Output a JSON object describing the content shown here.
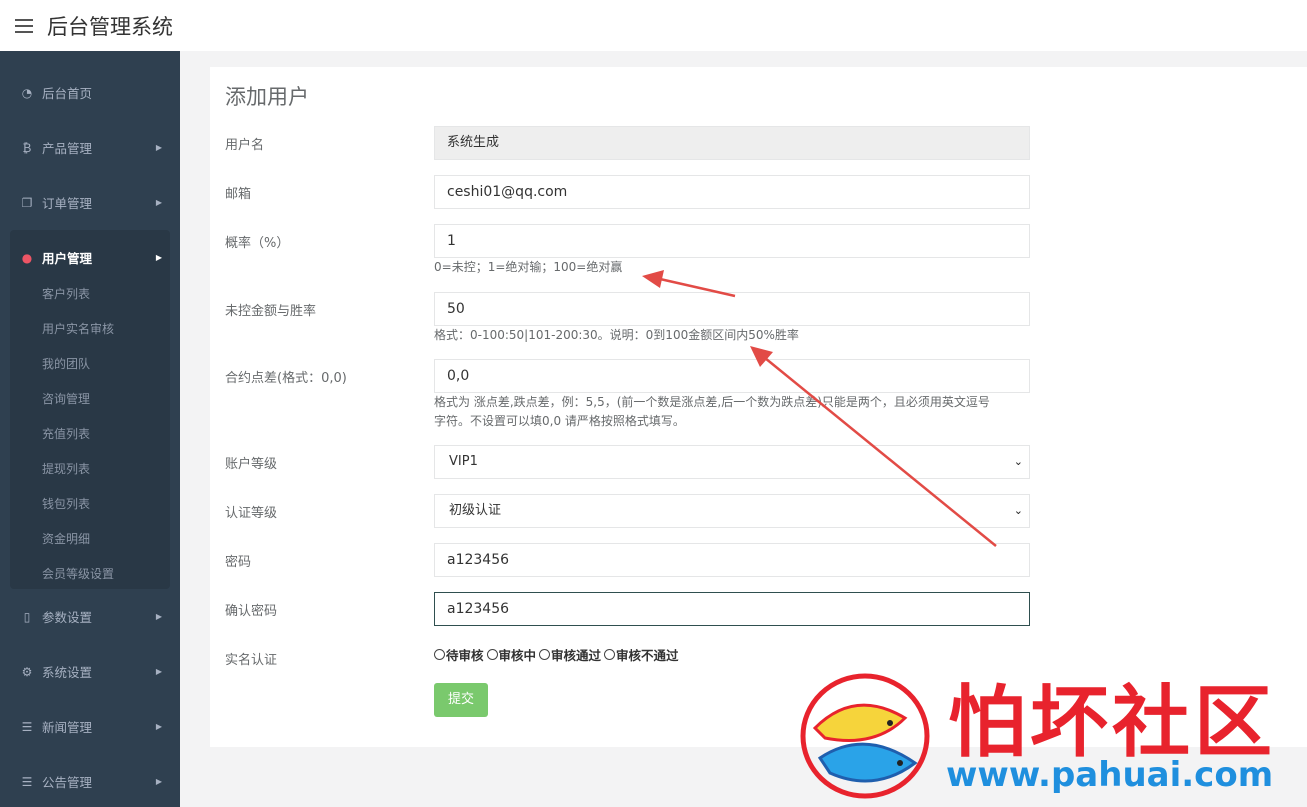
{
  "header": {
    "title": "后台管理系统",
    "menu_icon": "hamburger-menu-icon"
  },
  "sidebar": {
    "items": [
      {
        "label": "后台首页",
        "icon": "dashboard-icon",
        "has_arrow": false
      },
      {
        "label": "产品管理",
        "icon": "bitcoin-icon",
        "has_arrow": true
      },
      {
        "label": "订单管理",
        "icon": "copy-document-icon",
        "has_arrow": true
      },
      {
        "label": "用户管理",
        "icon": "user-icon",
        "has_arrow": true,
        "active": true,
        "children": [
          "客户列表",
          "用户实名审核",
          "我的团队",
          "咨询管理",
          "充值列表",
          "提现列表",
          "钱包列表",
          "资金明细",
          "会员等级设置"
        ]
      },
      {
        "label": "参数设置",
        "icon": "file-icon",
        "has_arrow": true
      },
      {
        "label": "系统设置",
        "icon": "gears-icon",
        "has_arrow": true
      },
      {
        "label": "新闻管理",
        "icon": "list-icon",
        "has_arrow": true
      },
      {
        "label": "公告管理",
        "icon": "list-icon",
        "has_arrow": true
      }
    ]
  },
  "form": {
    "title": "添加用户",
    "username": {
      "label": "用户名",
      "value": "系统生成"
    },
    "email": {
      "label": "邮箱",
      "value": "ceshi01@qq.com"
    },
    "probability": {
      "label": "概率（%）",
      "value": "1",
      "help": "0=未控；1=绝对输；100=绝对赢"
    },
    "uncontrolled": {
      "label": "未控金额与胜率",
      "value": "50",
      "help": "格式：0-100:50|101-200:30。说明：0到100金额区间内50%胜率"
    },
    "spread": {
      "label": "合约点差(格式：0,0)",
      "value": "0,0",
      "help_line1": "格式为 涨点差,跌点差，例：5,5，(前一个数是涨点差,后一个数为跌点差)只能是两个，且必须用英文逗号",
      "help_line2": "字符。不设置可以填0,0 请严格按照格式填写。"
    },
    "account_level": {
      "label": "账户等级",
      "selected": "VIP1"
    },
    "cert_level": {
      "label": "认证等级",
      "selected": "初级认证"
    },
    "password": {
      "label": "密码",
      "value": "a123456"
    },
    "confirm_password": {
      "label": "确认密码",
      "value": "a123456"
    },
    "realname": {
      "label": "实名认证",
      "options": [
        "待审核",
        "审核中",
        "审核通过",
        "审核不通过"
      ]
    },
    "submit_label": "提交"
  },
  "watermark": {
    "text": "怕坏社区",
    "url": "www.pahuai.com"
  },
  "colors": {
    "sidebar_bg": "#2f4050",
    "submit_bg": "#7ac96d",
    "active_icon": "#ed5565",
    "arrow": "#e24b46"
  }
}
